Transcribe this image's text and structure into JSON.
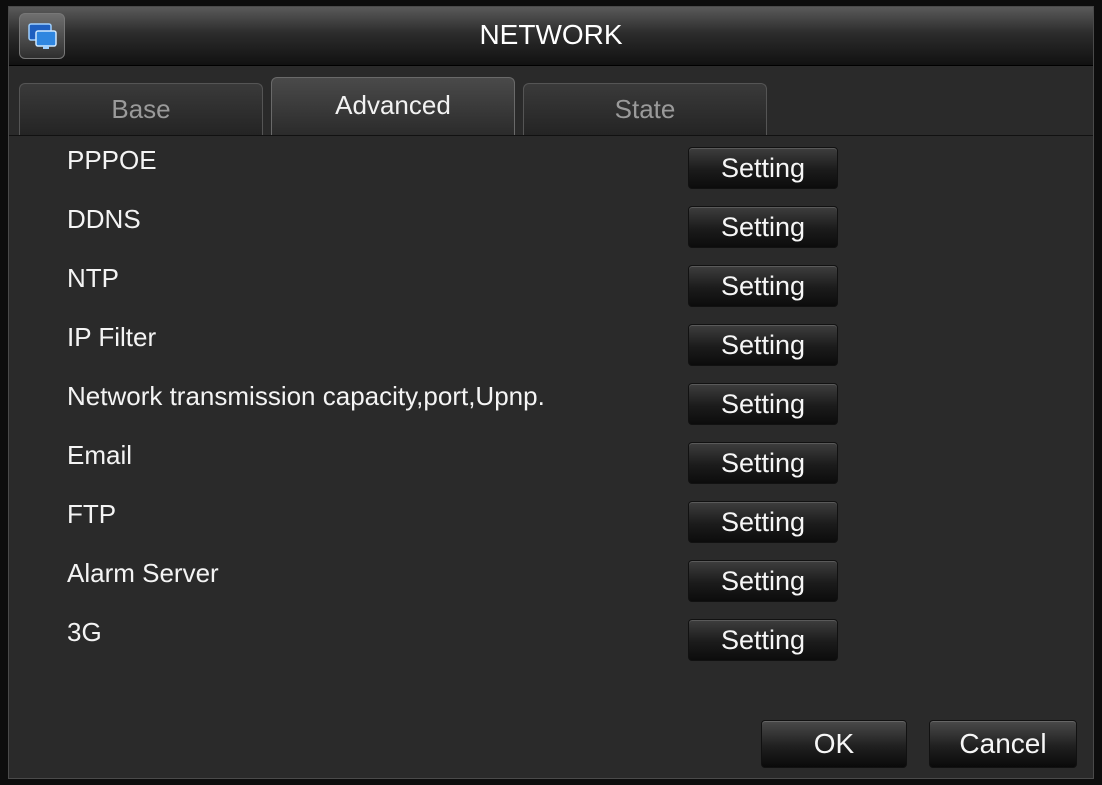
{
  "window": {
    "title": "NETWORK",
    "icon": "network-monitor-icon"
  },
  "tabs": [
    {
      "label": "Base",
      "active": false
    },
    {
      "label": "Advanced",
      "active": true
    },
    {
      "label": "State",
      "active": false
    }
  ],
  "rows": [
    {
      "label": "PPPOE",
      "button": "Setting"
    },
    {
      "label": "DDNS",
      "button": "Setting"
    },
    {
      "label": "NTP",
      "button": "Setting"
    },
    {
      "label": "IP Filter",
      "button": "Setting"
    },
    {
      "label": "Network transmission capacity,port,Upnp.",
      "button": "Setting"
    },
    {
      "label": "Email",
      "button": "Setting"
    },
    {
      "label": "FTP",
      "button": "Setting"
    },
    {
      "label": "Alarm Server",
      "button": "Setting"
    },
    {
      "label": "3G",
      "button": "Setting"
    }
  ],
  "footer": {
    "ok_label": "OK",
    "cancel_label": "Cancel"
  }
}
